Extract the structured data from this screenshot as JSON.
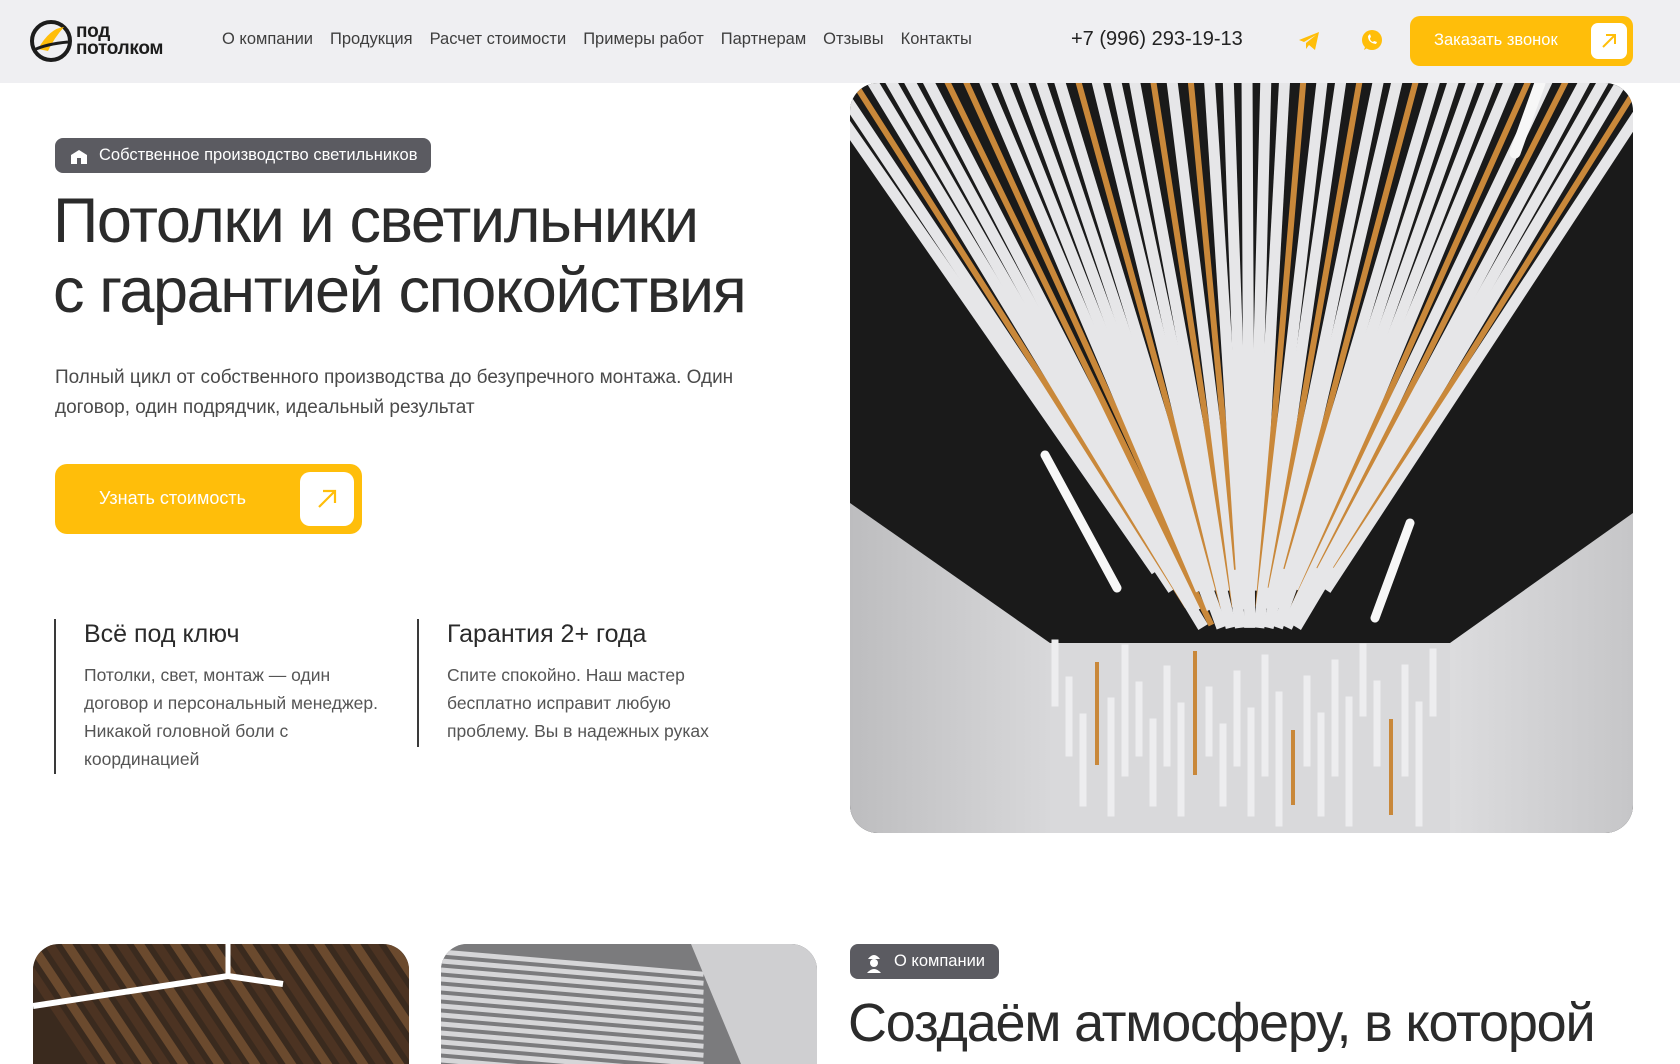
{
  "brand": {
    "line1": "под",
    "line2": "потолком"
  },
  "nav": {
    "items": [
      "О компании",
      "Продукция",
      "Расчет стоимости",
      "Примеры работ",
      "Партнерам",
      "Отзывы",
      "Контакты"
    ]
  },
  "header": {
    "phone": "+7 (996) 293-19-13",
    "telegram_icon": "telegram-icon",
    "whatsapp_icon": "whatsapp-icon",
    "cta_label": "Заказать звонок"
  },
  "hero": {
    "badge": "Собственное производство светильников",
    "title_line1": "Потолки и светильники",
    "title_line2": "с гарантией спокойствия",
    "description": "Полный цикл от собственного производства до безупречного монтажа. Один договор, один подрядчик, идеальный результат",
    "cta_label": "Узнать стоимость",
    "features": [
      {
        "title": "Всё под ключ",
        "text": "Потолки, свет, монтаж — один договор и персональный менеджер. Никакой головной боли с координацией"
      },
      {
        "title": "Гарантия 2+ года",
        "text": "Спите спокойно. Наш мастер бесплатно исправит любую проблему. Вы в надежных руках"
      }
    ]
  },
  "about": {
    "badge": "О компании",
    "title": "Создаём атмосферу, в которой"
  },
  "colors": {
    "accent": "#ffbe0a",
    "header_bg": "#efeff2",
    "badge_bg": "#5b5b61",
    "text": "#2b2b2b"
  }
}
